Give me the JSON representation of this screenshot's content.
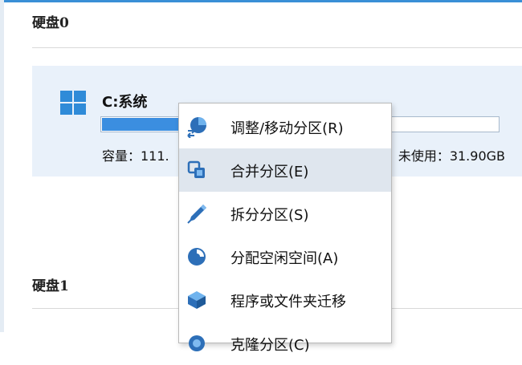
{
  "disks": [
    {
      "title": "硬盘0"
    },
    {
      "title": "硬盘1"
    }
  ],
  "partition": {
    "icon": "windows-icon",
    "name": "C:系统",
    "capacity_text": "容量：111.",
    "unused_text": "未使用：31.90GB",
    "usage_fraction": 0.72
  },
  "context_menu": {
    "items": [
      {
        "label": "调整/移动分区(R)",
        "icon": "resize-partition-icon"
      },
      {
        "label": "合并分区(E)",
        "icon": "merge-partition-icon",
        "highlighted": true
      },
      {
        "label": "拆分分区(S)",
        "icon": "split-partition-icon"
      },
      {
        "label": "分配空闲空间(A)",
        "icon": "allocate-space-icon"
      },
      {
        "label": "程序或文件夹迁移",
        "icon": "migrate-app-icon"
      },
      {
        "label": "克隆分区(C)",
        "icon": "clone-partition-icon"
      }
    ]
  },
  "colors": {
    "accent": "#2f8bd8",
    "card_background": "#e9f1fa",
    "menu_hover": "#dfe6ee",
    "bar_fill": "#3b8ee0"
  }
}
